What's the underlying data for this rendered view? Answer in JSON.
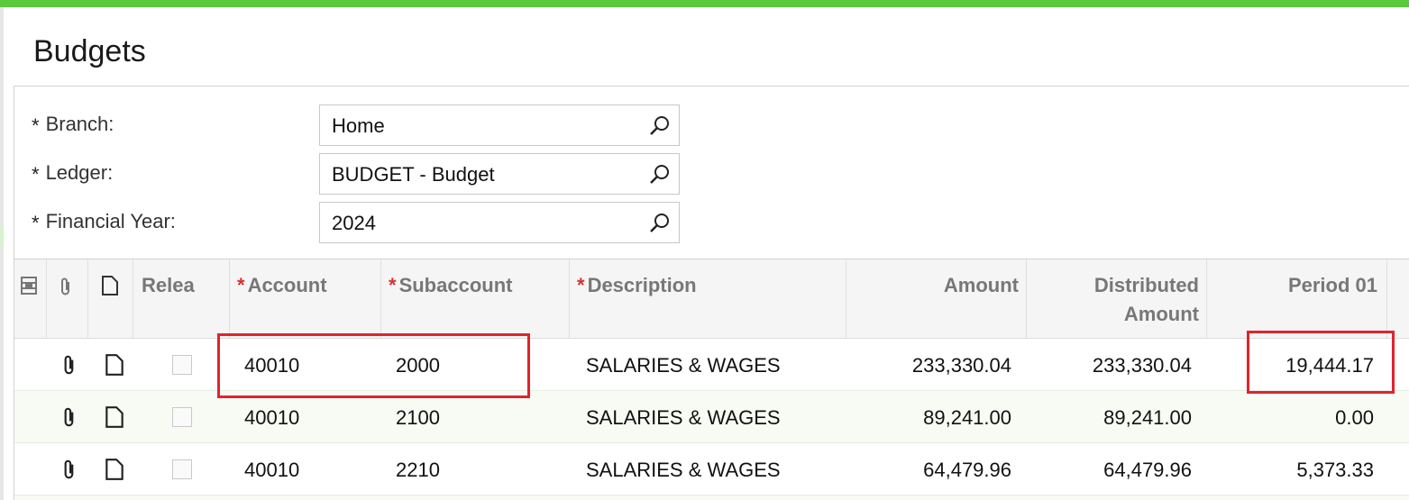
{
  "page": {
    "title": "Budgets"
  },
  "form": {
    "branch": {
      "label": "Branch:",
      "required": "*",
      "value": "Home"
    },
    "ledger": {
      "label": "Ledger:",
      "required": "*",
      "value": "BUDGET - Budget"
    },
    "financial_year": {
      "label": "Financial Year:",
      "required": "*",
      "value": "2024"
    }
  },
  "grid": {
    "columns": {
      "released": "Relea",
      "account": "Account",
      "subaccount": "Subaccount",
      "description": "Description",
      "amount": "Amount",
      "distributed_amount_line1": "Distributed",
      "distributed_amount_line2": "Amount",
      "period01": "Period 01",
      "required_mark": "*"
    },
    "rows": [
      {
        "account": "40010",
        "subaccount": "2000",
        "description": "SALARIES & WAGES",
        "amount": "233,330.04",
        "distributed": "233,330.04",
        "period01": "19,444.17"
      },
      {
        "account": "40010",
        "subaccount": "2100",
        "description": "SALARIES & WAGES",
        "amount": "89,241.00",
        "distributed": "89,241.00",
        "period01": "0.00"
      },
      {
        "account": "40010",
        "subaccount": "2210",
        "description": "SALARIES & WAGES",
        "amount": "64,479.96",
        "distributed": "64,479.96",
        "period01": "5,373.33"
      }
    ]
  },
  "colors": {
    "accent_bar": "#5cc83c",
    "highlight": "#e0242c",
    "required_star": "#d93030"
  },
  "icons": [
    "search-icon",
    "column-config-icon",
    "paperclip-icon",
    "document-icon"
  ]
}
